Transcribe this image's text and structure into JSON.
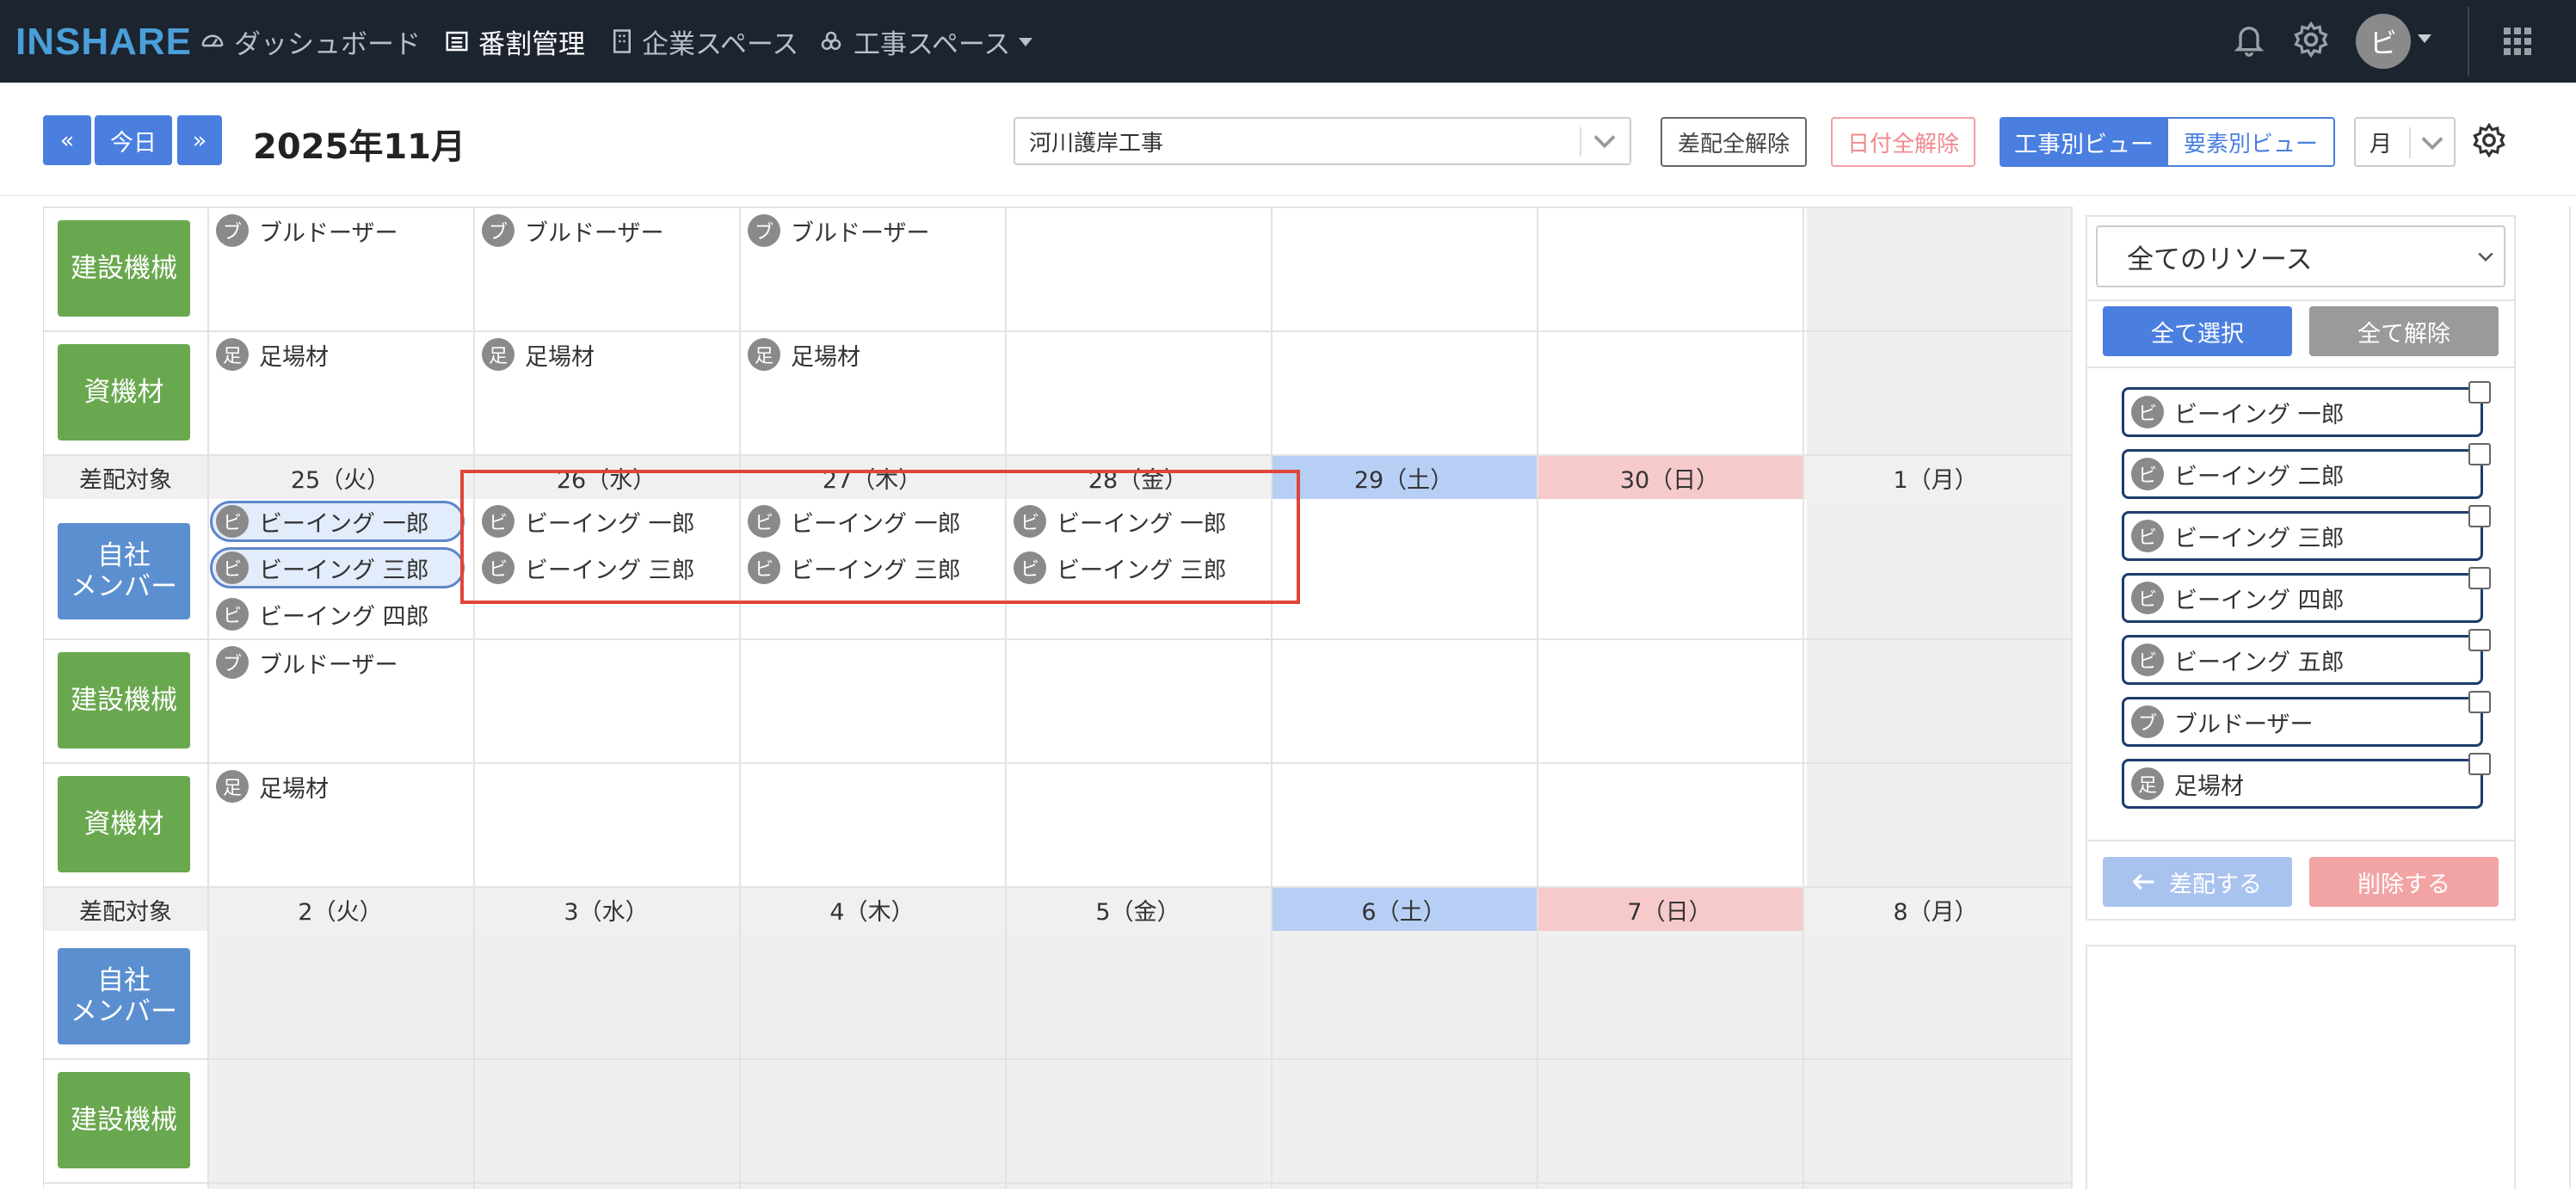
{
  "nav": {
    "logo": "INSHARE",
    "items": [
      {
        "label": "ダッシュボード",
        "active": false
      },
      {
        "label": "番割管理",
        "active": true
      },
      {
        "label": "企業スペース",
        "active": false
      },
      {
        "label": "工事スペース",
        "active": false
      }
    ],
    "avatar_initial": "ビ"
  },
  "toolbar": {
    "prev_label": "«",
    "today_label": "今日",
    "next_label": "»",
    "month_title": "2025年11月",
    "project_select": "河川護岸工事",
    "clear_assign_label": "差配全解除",
    "clear_date_label": "日付全解除",
    "view_by_project_label": "工事別ビュー",
    "view_by_element_label": "要素別ビュー",
    "period_select": "月"
  },
  "calendar": {
    "date_row_label": "差配対象",
    "row_labels": {
      "machine": "建設機械",
      "material": "資機材",
      "member_line1": "自社",
      "member_line2": "メンバー"
    },
    "week1": [
      "25（火）",
      "26（水）",
      "27（木）",
      "28（金）",
      "29（土）",
      "30（日）",
      "1（月）"
    ],
    "week2": [
      "2（火）",
      "3（水）",
      "4（木）",
      "5（金）",
      "6（土）",
      "7（日）",
      "8（月）"
    ],
    "items": {
      "bulldozer": "ブルドーザー",
      "scaffold": "足場材",
      "ichiro": "ビーイング 一郎",
      "saburo": "ビーイング 三郎",
      "shiro": "ビーイング 四郎"
    },
    "avatars": {
      "bi": "ビ",
      "bu": "ブ",
      "ashi": "足"
    }
  },
  "panel": {
    "filter_select": "全てのリソース",
    "select_all_label": "全て選択",
    "deselect_all_label": "全て解除",
    "resources": [
      {
        "avatar": "ビ",
        "name": "ビーイング 一郎"
      },
      {
        "avatar": "ビ",
        "name": "ビーイング 二郎"
      },
      {
        "avatar": "ビ",
        "name": "ビーイング 三郎"
      },
      {
        "avatar": "ビ",
        "name": "ビーイング 四郎"
      },
      {
        "avatar": "ビ",
        "name": "ビーイング 五郎"
      },
      {
        "avatar": "ブ",
        "name": "ブルドーザー"
      },
      {
        "avatar": "足",
        "name": "足場材"
      }
    ],
    "assign_label": "差配する",
    "delete_label": "削除する"
  },
  "colors": {
    "navbar": "#1c2430",
    "primary": "#4a7fe0",
    "label_green": "#6aa84f",
    "label_blue": "#5b8fd0",
    "saturday": "#b8cff5",
    "sunday": "#f6c9cb",
    "selection_box": "#e0453a"
  }
}
